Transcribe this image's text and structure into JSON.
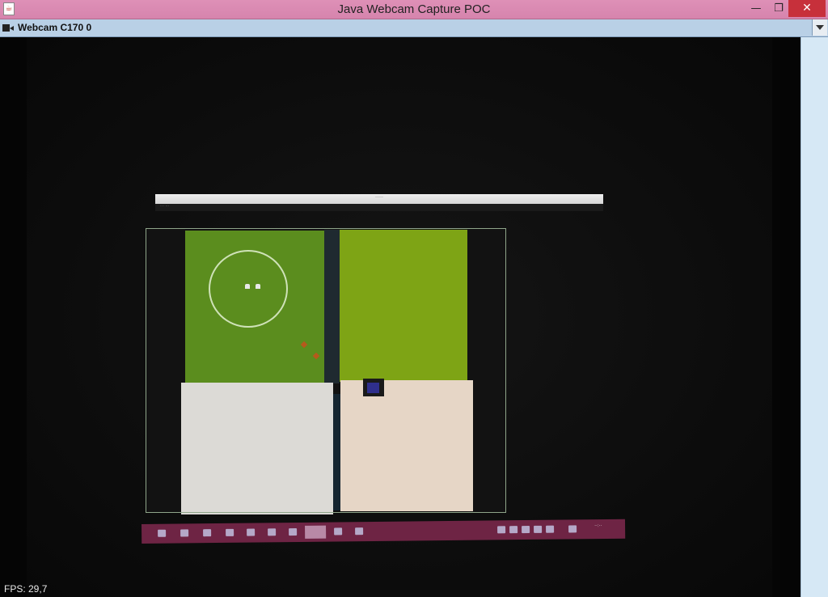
{
  "window": {
    "title": "Java Webcam Capture POC",
    "minimize_symbol": "—",
    "restore_symbol": "❐",
    "close_symbol": "✕",
    "titlebar_color": "#d684ad",
    "close_color": "#c7303b"
  },
  "camera_selector": {
    "selected": "Webcam C170 0",
    "icon": "camera-icon",
    "dropdown_icon": "chevron-down-icon"
  },
  "video": {
    "content": "webcam photo of a monitor showing a 2D top-down game window",
    "grass_color": "#5b8d1e",
    "floor_color": "#dcdad6"
  },
  "status": {
    "fps": "FPS: 29,7"
  }
}
